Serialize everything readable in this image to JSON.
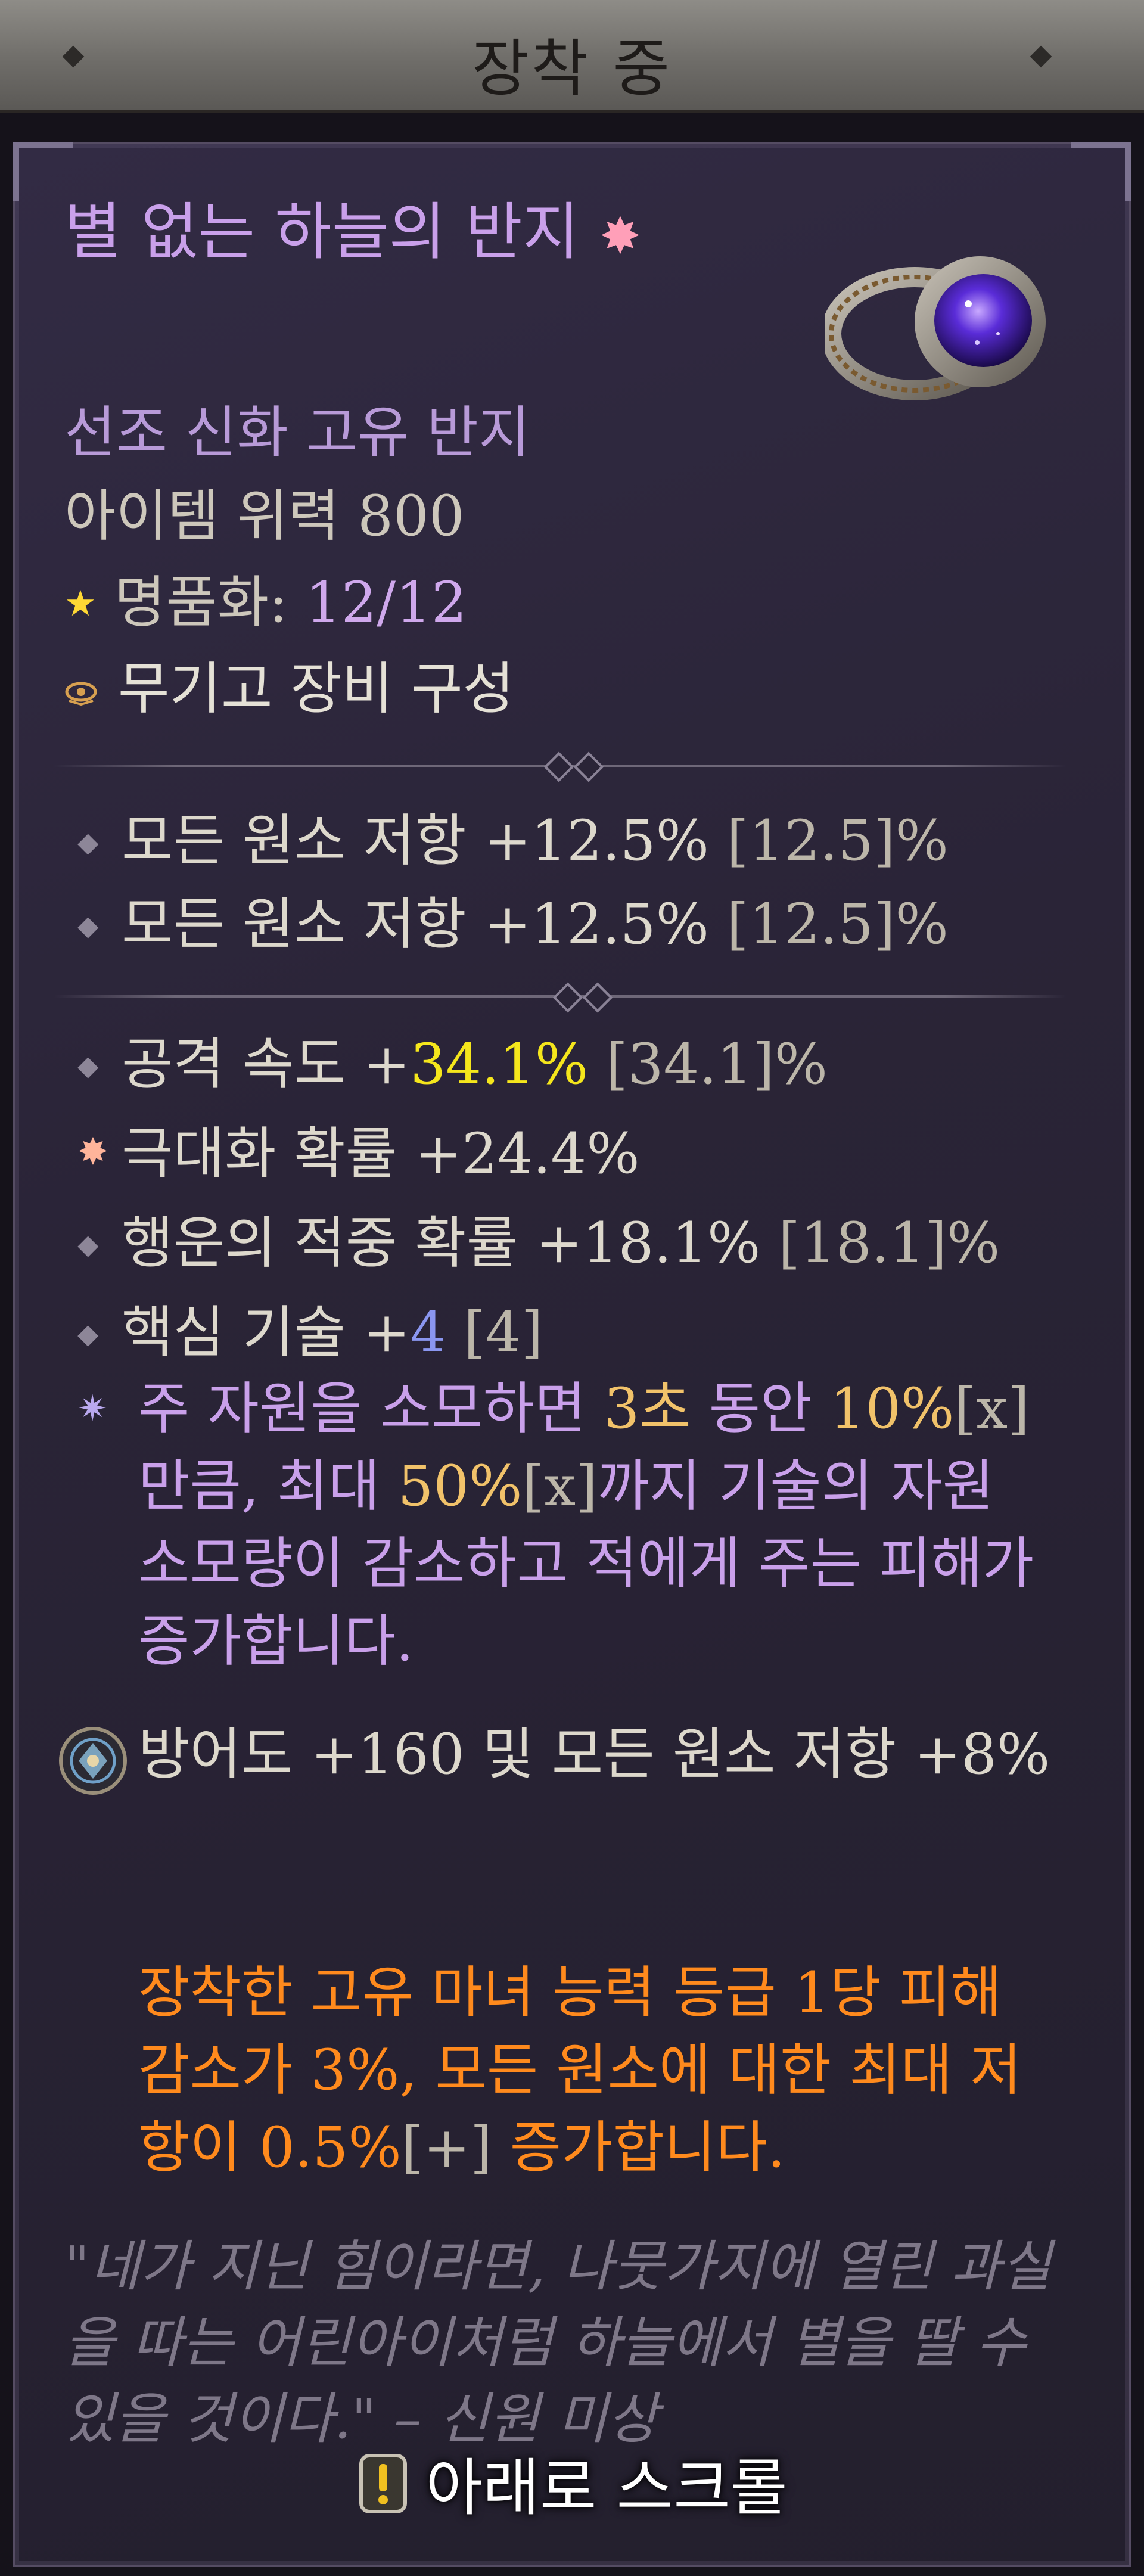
{
  "header": {
    "title": "장착 중"
  },
  "item": {
    "name": "별 없는 하늘의 반지",
    "name_icon": "ancestral-star-icon",
    "subtitle": "선조 신화 고유 반지",
    "power": "아이템 위력 800",
    "masterwork_label": "명품화:",
    "masterwork_value": "12/12",
    "armory": "무기고 장비 구성"
  },
  "implicits": [
    {
      "text": "모든 원소 저항 +12.5%",
      "range": "[12.5]%"
    },
    {
      "text": "모든 원소 저항 +12.5%",
      "range": "[12.5]%"
    }
  ],
  "affixes": {
    "attack_speed": {
      "label": "공격 속도 +",
      "value": "34.1%",
      "range": "[34.1]%"
    },
    "crit": {
      "text": "극대화 확률 +24.4%"
    },
    "lucky_hit": {
      "text": "행운의 적중 확률 +18.1%",
      "range": "[18.1]%"
    },
    "core": {
      "label": "핵심 기술 +",
      "value": "4",
      "range": "[4]"
    }
  },
  "special_affix": {
    "p1": "주 자원을 소모하면 ",
    "n1": "3초",
    "p2": " 동안 ",
    "n2": "10%",
    "g1": "[x]",
    "p3": "만큼, 최대 ",
    "n3": "50%",
    "g2": "[x]",
    "p4": "까지 기술의 자원 소모량이 감소하고 적에게 주는 피해가 증가합니다."
  },
  "socket": {
    "text": "방어도 +160 및 모든 원소 저항 +8%"
  },
  "unique_power": {
    "p1": "장착한 고유 ",
    "n1": "마녀 능력 등급 1당 피해 감소",
    "p2": "가 3%, 모든 원소에 대한 최대 저항이 0.5%",
    "g1": "[+]",
    "p3": " 증가합니다."
  },
  "flavor": "\"네가 지닌 힘이라면, 나뭇가지에 열린 과실을 따는 어린아이처럼 하늘에서 별을 딸 수 있을 것이다.\" – 신원 미상",
  "scroll_hint": "아래로 스크롤",
  "colors": {
    "unique_name": "#c9a0ea",
    "unique_power": "#ff8a1d",
    "greater_affix": "#f5e61c"
  }
}
